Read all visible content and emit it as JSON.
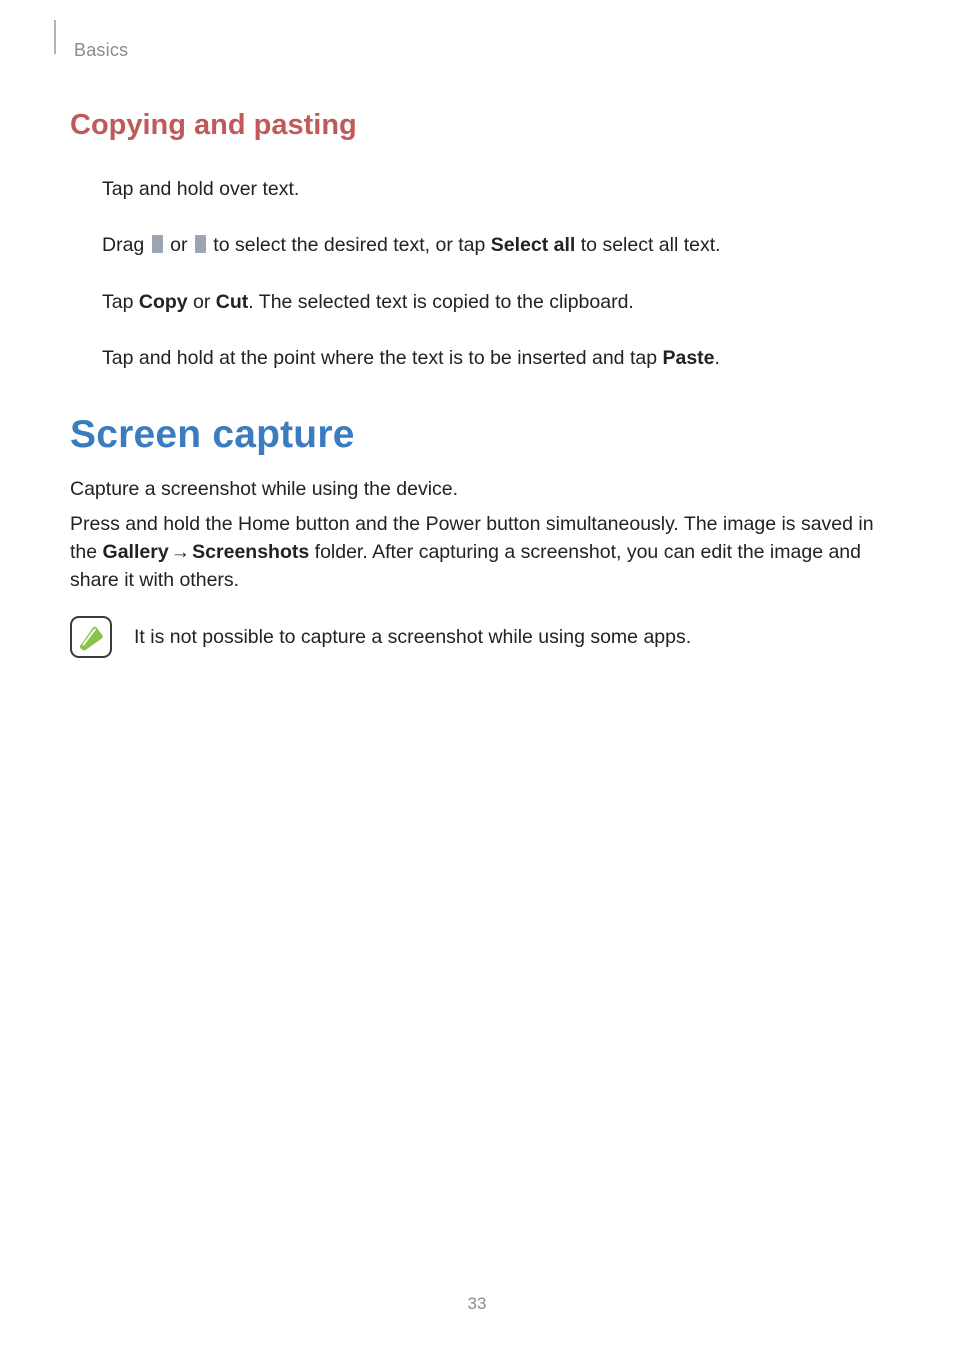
{
  "colors": {
    "h2_accent": "#c05a5a",
    "h1_accent": "#3b7bbf",
    "note_icon_fill": "#8bc34a"
  },
  "breadcrumb": "Basics",
  "section1": {
    "title": "Copying and pasting",
    "step1": "Tap and hold over text.",
    "step2_a": "Drag ",
    "step2_b": " or ",
    "step2_c": " to select the desired text, or tap ",
    "step2_bold": "Select all",
    "step2_d": " to select all text.",
    "step3_a": "Tap ",
    "step3_bold1": "Copy",
    "step3_b": " or ",
    "step3_bold2": "Cut",
    "step3_c": ". The selected text is copied to the clipboard.",
    "step4_a": "Tap and hold at the point where the text is to be inserted and tap ",
    "step4_bold": "Paste",
    "step4_b": "."
  },
  "section2": {
    "title": "Screen capture",
    "para1": "Capture a screenshot while using the device.",
    "para2_a": "Press and hold the Home button and the Power button simultaneously. The image is saved in the ",
    "para2_bold1": "Gallery",
    "para2_arrow": " → ",
    "para2_bold2": "Screenshots",
    "para2_b": " folder. After capturing a screenshot, you can edit the image and share it with others.",
    "note": "It is not possible to capture a screenshot while using some apps."
  },
  "page_number": "33"
}
